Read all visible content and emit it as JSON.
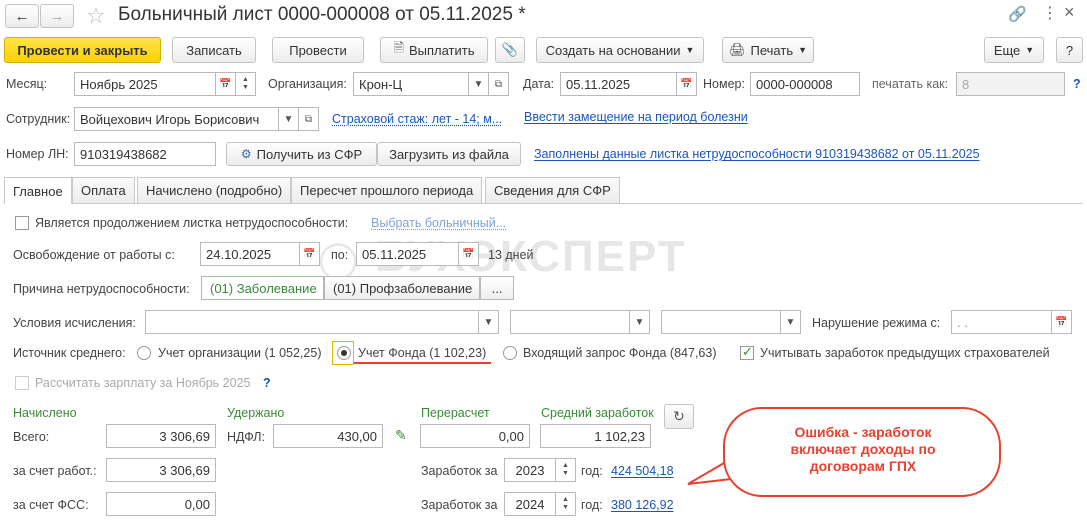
{
  "window": {
    "title": "Больничный лист 0000-000008 от 05.11.2025 *"
  },
  "toolbar": {
    "post_close": "Провести и закрыть",
    "save": "Записать",
    "post": "Провести",
    "pay": "Выплатить",
    "create_based": "Создать на основании",
    "print": "Печать",
    "more": "Еще",
    "help": "?"
  },
  "header": {
    "month_label": "Месяц:",
    "month_value": "Ноябрь 2025",
    "org_label": "Организация:",
    "org_value": "Крон-Ц",
    "date_label": "Дата:",
    "date_value": "05.11.2025",
    "number_label": "Номер:",
    "number_value": "0000-000008",
    "print_as_label": "печатать как:",
    "print_as_value": "8",
    "help": "?",
    "employee_label": "Сотрудник:",
    "employee_value": "Войцехович Игорь Борисович",
    "insurance_link": "Страховой стаж: лет - 14; м...",
    "replacement_link": "Ввести замещение на период болезни",
    "ln_label": "Номер ЛН:",
    "ln_value": "910319438682",
    "get_sfr": "Получить из СФР",
    "load_file": "Загрузить из файла",
    "filled_link": "Заполнены данные листка нетрудоспособности 910319438682 от 05.11.2025"
  },
  "tabs": [
    "Главное",
    "Оплата",
    "Начислено (подробно)",
    "Пересчет прошлого периода",
    "Сведения для СФР"
  ],
  "main": {
    "continuation_label": "Является продолжением листка нетрудоспособности:",
    "choose_link": "Выбрать больничный...",
    "release_label": "Освобождение от работы с:",
    "release_from": "24.10.2025",
    "to_label": "по:",
    "release_to": "05.11.2025",
    "days": "13 дней",
    "reason_label": "Причина нетрудоспособности:",
    "reason_1": "(01) Заболевание",
    "reason_2": "(01) Профзаболевание",
    "reason_more": "...",
    "calc_conditions_label": "Условия исчисления:",
    "violation_label": "Нарушение режима с:",
    "violation_value": " .  .",
    "avg_source_label": "Источник среднего:",
    "src_org": "Учет организации (1 052,25)",
    "src_fund": "Учет Фонда (1 102,23)",
    "src_request": "Входящий запрос Фонда (847,63)",
    "prev_insurers": "Учитывать заработок предыдущих страхователей",
    "calc_salary": "Рассчитать зарплату за Ноябрь 2025",
    "calc_help": "?"
  },
  "totals": {
    "accrued_title": "Начислено",
    "withheld_title": "Удержано",
    "recalc_title": "Перерасчет",
    "avg_title": "Средний заработок",
    "total_label": "Всего:",
    "total_value": "3 306,69",
    "ndfl_label": "НДФЛ:",
    "ndfl_value": "430,00",
    "recalc_value": "0,00",
    "avg_value": "1 102,23",
    "employer_label": "за счет работ.:",
    "employer_value": "3 306,69",
    "fss_label": "за счет ФСС:",
    "fss_value": "0,00",
    "earnings_label": "Заработок за",
    "year_label": "год:",
    "year1": "2023",
    "earn1": "424 504,18",
    "year2": "2024",
    "earn2": "380 126,92"
  },
  "watermark": "БУХЭКСПЕРТ",
  "callout": "Ошибка - заработок включает доходы по договорам ГПХ",
  "colors": {
    "accent_yellow": "#fbd200",
    "link": "#1c55b8",
    "green": "#3a8a3a",
    "callout_red": "#e8412f"
  }
}
